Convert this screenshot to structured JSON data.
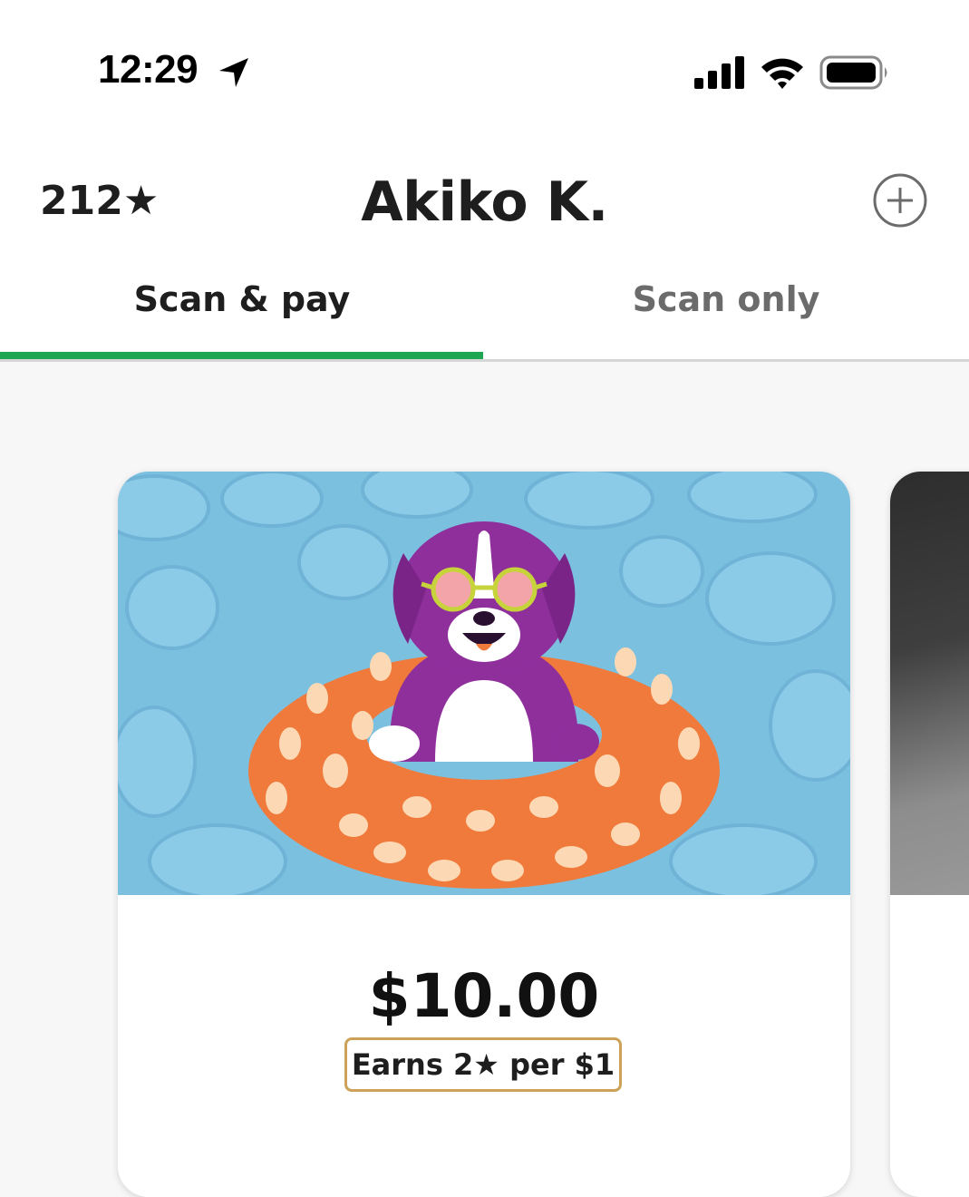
{
  "status_bar": {
    "time": "12:29",
    "icons": [
      "location-arrow-icon",
      "cellular-signal-icon",
      "wifi-icon",
      "battery-icon"
    ]
  },
  "header": {
    "stars": "212★",
    "name": "Akiko K.",
    "add_icon": "plus-circle-icon"
  },
  "tabs": [
    {
      "label": "Scan & pay",
      "selected": true
    },
    {
      "label": "Scan only",
      "selected": false
    }
  ],
  "card": {
    "amount": "$10.00",
    "earn_label": "Earns 2★ per $1"
  },
  "colors": {
    "accent_green": "#1fa652",
    "badge_gold": "#cba258",
    "pool_blue": "#7cc0e0",
    "float_orange": "#f07a3c",
    "dog_purple": "#8f2f9c"
  }
}
